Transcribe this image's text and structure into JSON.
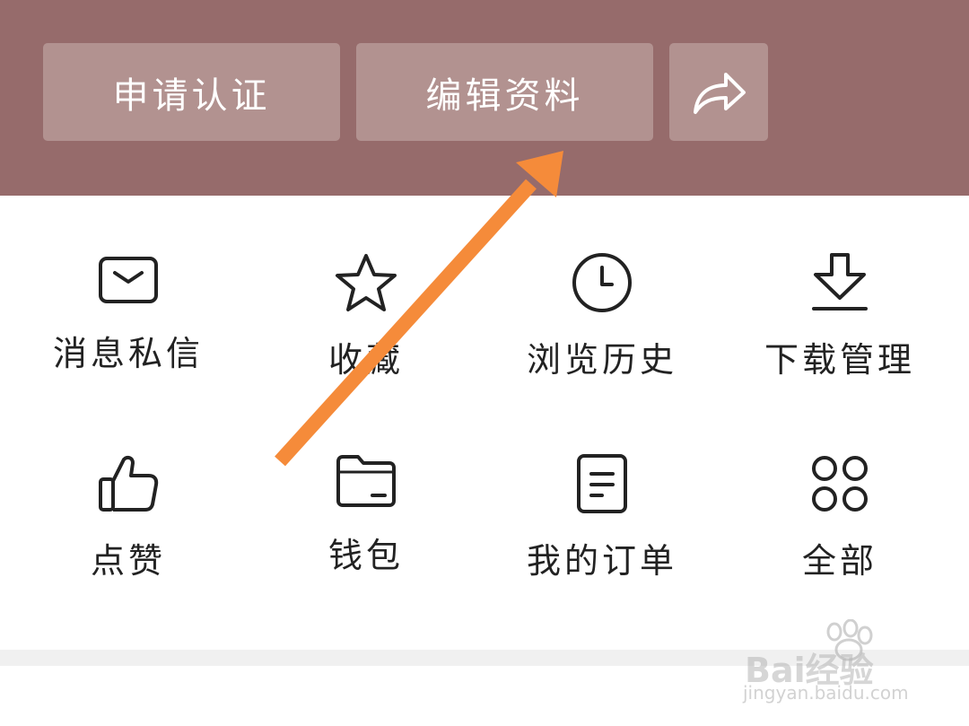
{
  "header": {
    "buttons": [
      {
        "label": "申请认证"
      },
      {
        "label": "编辑资料"
      }
    ],
    "share_icon": "share-arrow-icon"
  },
  "grid": {
    "items": [
      {
        "label": "消息私信",
        "icon": "envelope-icon"
      },
      {
        "label": "收藏",
        "icon": "star-icon"
      },
      {
        "label": "浏览历史",
        "icon": "clock-icon"
      },
      {
        "label": "下载管理",
        "icon": "download-icon"
      },
      {
        "label": "点赞",
        "icon": "thumbs-up-icon"
      },
      {
        "label": "钱包",
        "icon": "wallet-folder-icon"
      },
      {
        "label": "我的订单",
        "icon": "order-document-icon"
      },
      {
        "label": "全部",
        "icon": "grid-four-circles-icon"
      }
    ]
  },
  "watermark": {
    "brand": "Bai经验",
    "url": "jingyan.baidu.com"
  },
  "colors": {
    "header_bg": "#966b6b",
    "header_button_bg": "#b29290",
    "annotation_arrow": "#f58b3a"
  }
}
